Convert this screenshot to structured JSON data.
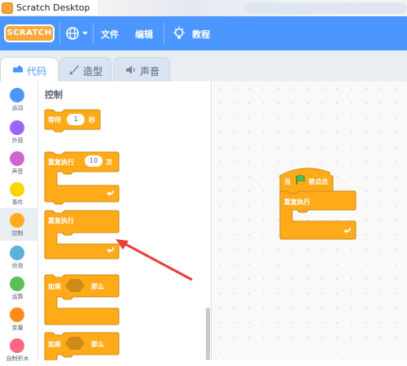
{
  "window": {
    "title": "Scratch Desktop"
  },
  "menubar": {
    "logo": "SCRATCH",
    "file": "文件",
    "edit": "编辑",
    "tutorials": "教程"
  },
  "tabs": [
    {
      "label": "代码",
      "icon": "code-icon",
      "active": true
    },
    {
      "label": "造型",
      "icon": "brush-icon",
      "active": false
    },
    {
      "label": "声音",
      "icon": "speaker-icon",
      "active": false
    }
  ],
  "categories": [
    {
      "label": "运动",
      "color": "#4c97ff"
    },
    {
      "label": "外观",
      "color": "#9966ff"
    },
    {
      "label": "声音",
      "color": "#cf63cf"
    },
    {
      "label": "事件",
      "color": "#ffd500"
    },
    {
      "label": "控制",
      "color": "#ffab19",
      "selected": true
    },
    {
      "label": "侦测",
      "color": "#5cb1d6"
    },
    {
      "label": "运算",
      "color": "#59c059"
    },
    {
      "label": "变量",
      "color": "#ff8c1a"
    },
    {
      "label": "自制积木",
      "color": "#ff6680"
    }
  ],
  "palette": {
    "title": "控制",
    "wait": {
      "label": "等待",
      "value": "1",
      "unit": "秒"
    },
    "repeat": {
      "label": "重复执行",
      "value": "10",
      "unit": "次"
    },
    "forever": {
      "label": "重复执行"
    },
    "if_then": {
      "label": "如果",
      "then": "那么"
    },
    "if_then_2": {
      "label": "如果",
      "then": "那么"
    }
  },
  "workspace": {
    "hat": {
      "when": "当",
      "clicked": "被点击"
    },
    "forever": {
      "label": "重复执行"
    }
  },
  "colors": {
    "menubar": "#4c97ff",
    "control": "#ffab19",
    "control_border": "#cf8b17",
    "annotation_arrow": "#e8403a"
  }
}
